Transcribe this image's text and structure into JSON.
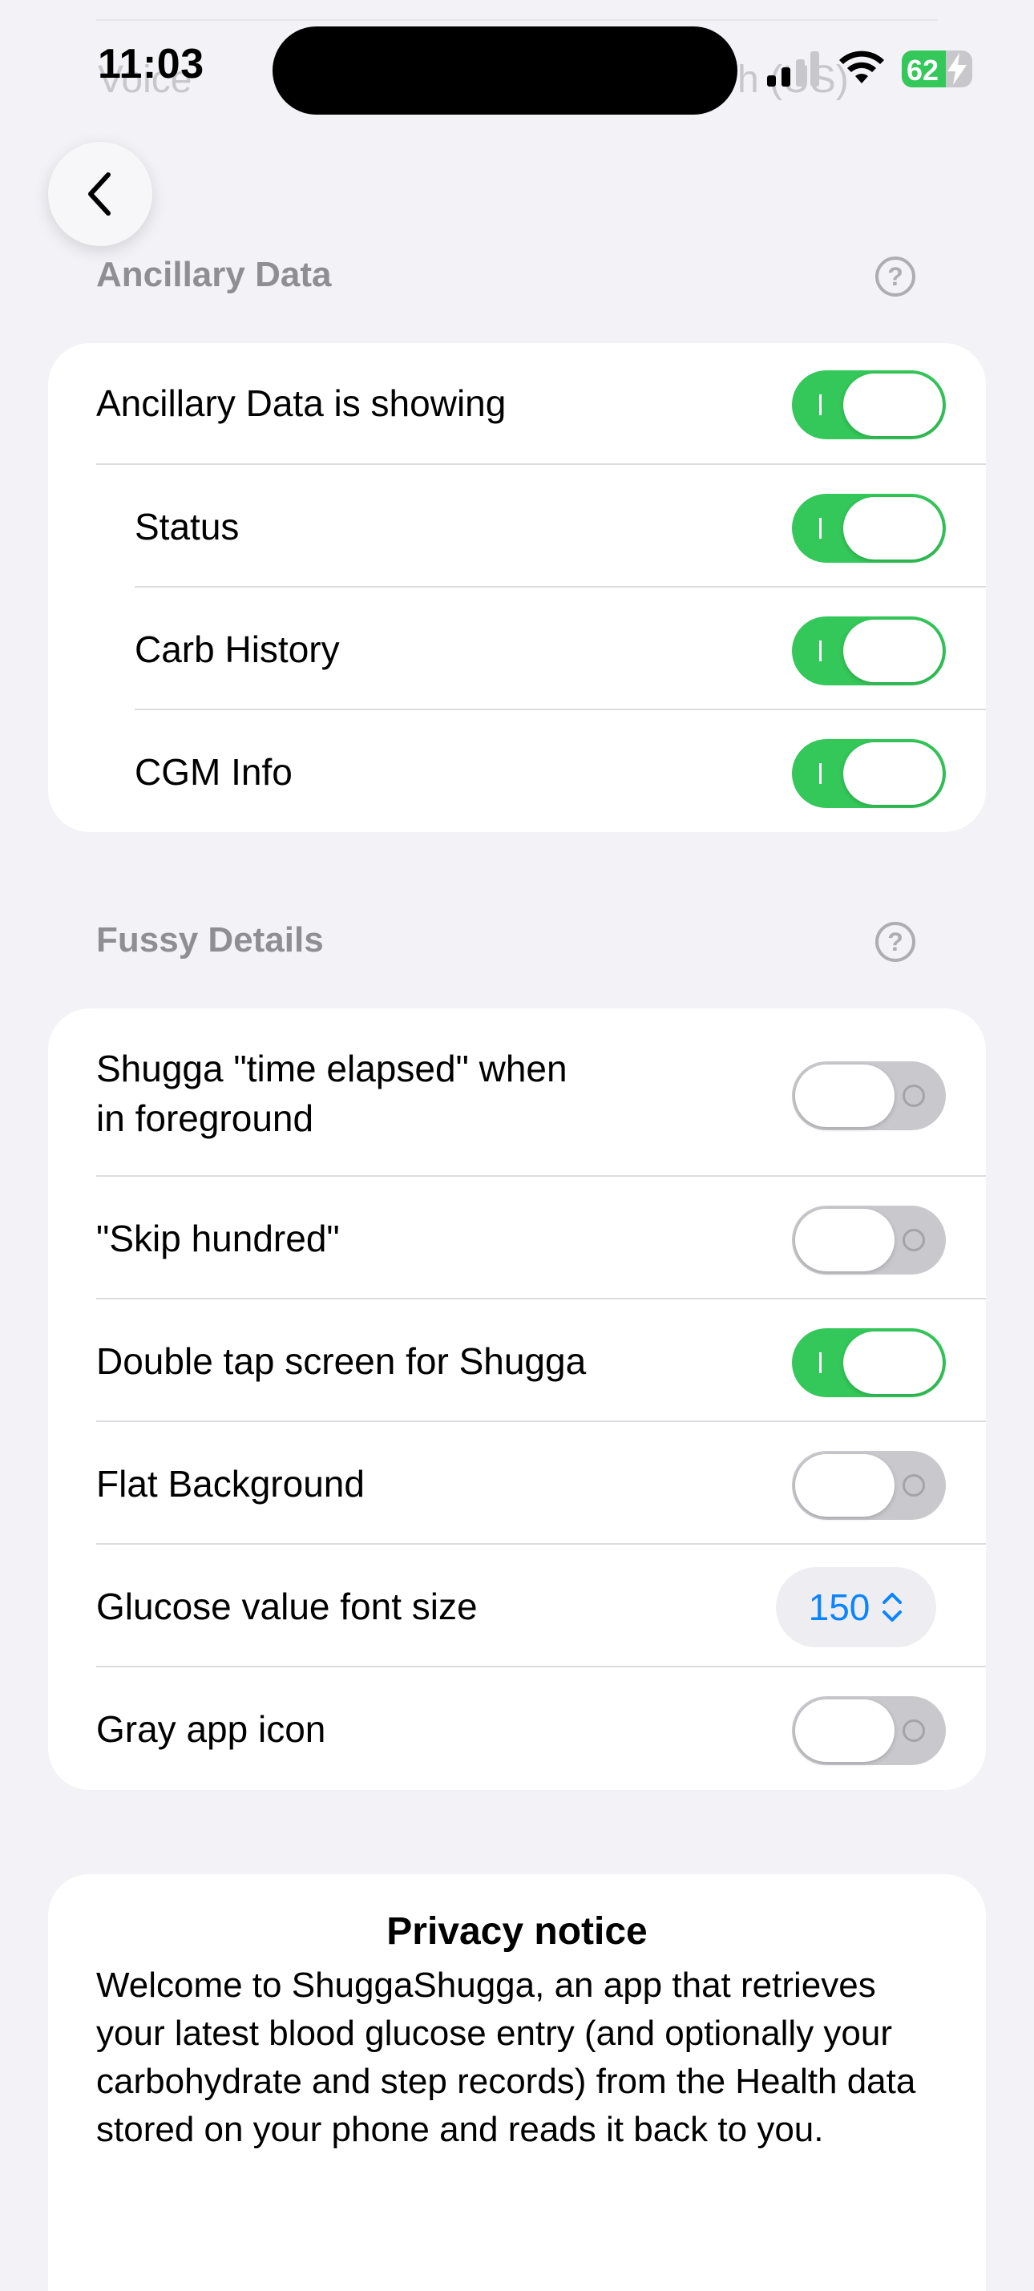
{
  "status_bar": {
    "time": "11:03",
    "battery": "62",
    "battery_level_percent": 62,
    "signal_icon": "cellular-signal-icon",
    "wifi_icon": "wifi-icon",
    "bolt_icon": "charging-bolt-icon"
  },
  "behind_text": {
    "left": "Voice",
    "right": "h (US)"
  },
  "back_button": {
    "icon": "chevron-left-icon"
  },
  "ancillary": {
    "header": "Ancillary Data",
    "rows": [
      {
        "label": "Ancillary Data is showing",
        "on": true
      },
      {
        "label": "Status",
        "on": true
      },
      {
        "label": "Carb History",
        "on": true
      },
      {
        "label": "CGM Info",
        "on": true
      }
    ]
  },
  "fussy": {
    "header": "Fussy Details",
    "rows": [
      {
        "label_line1": "Shugga \"time elapsed\" when",
        "label_line2": "in foreground",
        "on": false
      },
      {
        "label": "\"Skip hundred\"",
        "on": false
      },
      {
        "label": "Double tap screen for Shugga",
        "on": true
      },
      {
        "label": "Flat Background",
        "on": false
      },
      {
        "label": "Glucose value font size",
        "value": "150"
      },
      {
        "label": "Gray app icon",
        "on": false
      }
    ]
  },
  "privacy": {
    "title": "Privacy notice",
    "body": "Welcome to ShuggaShugga, an app that retrieves your latest blood glucose entry (and optionally your carbohydrate and step records) from the Health data stored on your phone and reads it back to you."
  },
  "colors": {
    "background": "#f2f2f7",
    "toggle_on": "#34c759",
    "toggle_off": "#c9c9cd",
    "accent_blue": "#0a84ff",
    "header_gray": "#8e8e93"
  }
}
